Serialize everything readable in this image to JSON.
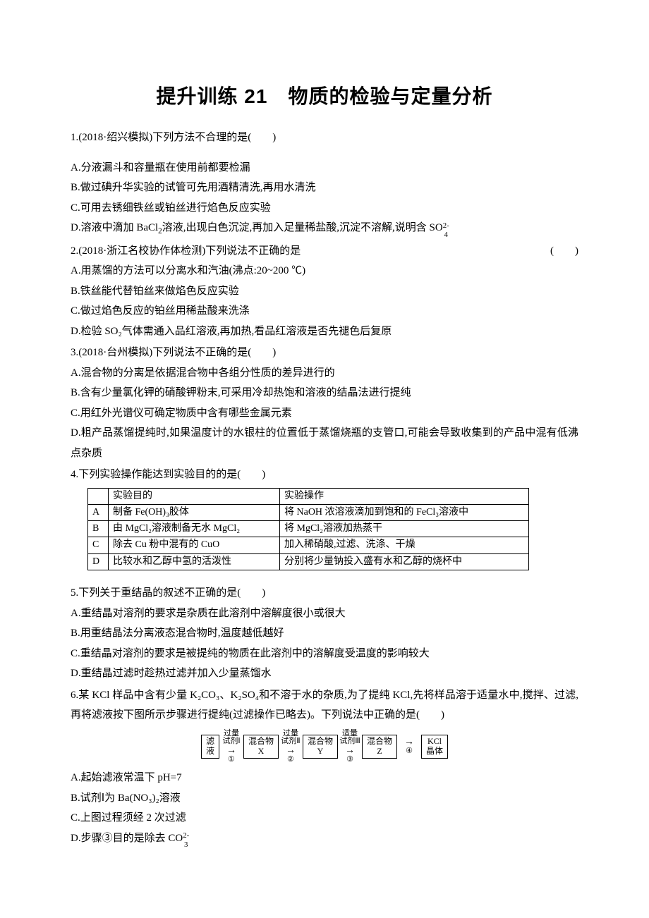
{
  "title": "提升训练 21　物质的检验与定量分析",
  "q1": {
    "stem": "1.(2018·绍兴模拟)下列方法不合理的是(　　)",
    "A": "A.分液漏斗和容量瓶在使用前都要检漏",
    "B": "B.做过碘升华实验的试管可先用酒精清洗,再用水清洗",
    "C": "C.可用去锈细铁丝或铂丝进行焰色反应实验",
    "D_pre": "D.溶液中滴加 BaCl",
    "D_mid": "溶液,出现白色沉淀,再加入足量稀盐酸,沉淀不溶解,说明含 S"
  },
  "q2": {
    "stem_left": "2.(2018·浙江名校协作体检测)下列说法不正确的是",
    "stem_right": "(　　)",
    "A": "A.用蒸馏的方法可以分离水和汽油(沸点:20~200 ℃)",
    "B": "B.铁丝能代替铂丝来做焰色反应实验",
    "C": "C.做过焰色反应的铂丝用稀盐酸来洗涤",
    "D": "D.检验 SO₂气体需通入品红溶液,再加热,看品红溶液是否先褪色后复原"
  },
  "q3": {
    "stem": "3.(2018·台州模拟)下列说法不正确的是(　　)",
    "A": "A.混合物的分离是依据混合物中各组分性质的差异进行的",
    "B": "B.含有少量氯化钾的硝酸钾粉末,可采用冷却热饱和溶液的结晶法进行提纯",
    "C": "C.用红外光谱仪可确定物质中含有哪些金属元素",
    "D": "D.粗产品蒸馏提纯时,如果温度计的水银柱的位置低于蒸馏烧瓶的支管口,可能会导致收集到的产品中混有低沸点杂质"
  },
  "q4": {
    "stem": "4.下列实验操作能达到实验目的的是(　　)",
    "head1": "实验目的",
    "head2": "实验操作",
    "rows": [
      {
        "k": "A",
        "c1": "制备 Fe(OH)₃胶体",
        "c2": "将 NaOH 浓溶液滴加到饱和的 FeCl₃溶液中"
      },
      {
        "k": "B",
        "c1": "由 MgCl₂溶液制备无水 MgCl₂",
        "c2": "将 MgCl₂溶液加热蒸干"
      },
      {
        "k": "C",
        "c1": "除去 Cu 粉中混有的 CuO",
        "c2": "加入稀硝酸,过滤、洗涤、干燥"
      },
      {
        "k": "D",
        "c1": "比较水和乙醇中氢的活泼性",
        "c2": "分别将少量钠投入盛有水和乙醇的烧杯中"
      }
    ]
  },
  "q5": {
    "stem": "5.下列关于重结晶的叙述不正确的是(　　)",
    "A": "A.重结晶对溶剂的要求是杂质在此溶剂中溶解度很小或很大",
    "B": "B.用重结晶法分离液态混合物时,温度越低越好",
    "C": "C.重结晶对溶剂的要求是被提纯的物质在此溶剂中的溶解度受温度的影响较大",
    "D": "D.重结晶过滤时趁热过滤并加入少量蒸馏水"
  },
  "q6": {
    "stem1": "6.某 KCl 样品中含有少量 K₂CO₃、K₂SO₄和不溶于水的杂质,为了提纯 KCl,先将样品溶于适量水中,搅拌、过滤,再将滤液按下图所示步骤进行提纯(过滤操作已略去)。下列说法中正确的是(　　)",
    "flow": {
      "b1": "滤\n液",
      "a1_top": "过量\n试剂Ⅰ",
      "a1_bot": "①",
      "b2": "混合物\nX",
      "a2_top": "过量\n试剂Ⅱ",
      "a2_bot": "②",
      "b3": "混合物\nY",
      "a3_top": "适量\n试剂Ⅲ",
      "a3_bot": "③",
      "b4": "混合物\nZ",
      "a4_top": "",
      "a4_bot": "④",
      "b5": "KCl\n晶体"
    },
    "A": "A.起始滤液常温下 pH=7",
    "B": "B.试剂Ⅰ为 Ba(NO₃)₂溶液",
    "C": "C.上图过程须经 2 次过滤",
    "D_pre": "D.步骤③目的是除去 C"
  }
}
